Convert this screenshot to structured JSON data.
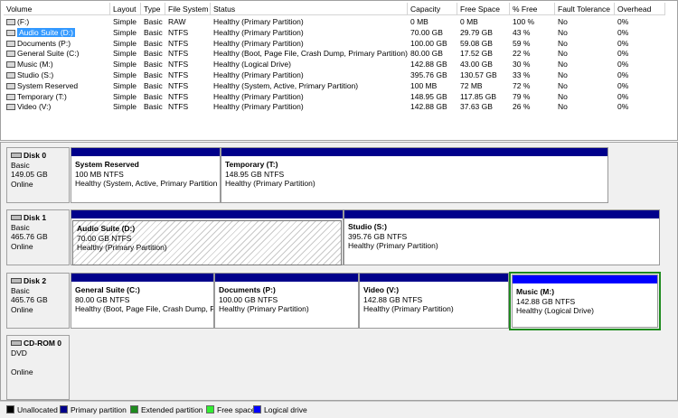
{
  "columns": [
    "Volume",
    "Layout",
    "Type",
    "File System",
    "Status",
    "Capacity",
    "Free Space",
    "% Free",
    "Fault Tolerance",
    "Overhead"
  ],
  "volumes": [
    {
      "name": "(F:)",
      "layout": "Simple",
      "type": "Basic",
      "fs": "RAW",
      "status": "Healthy (Primary Partition)",
      "capacity": "0 MB",
      "free": "0 MB",
      "pct": "100 %",
      "fault": "No",
      "overhead": "0%"
    },
    {
      "name": "Audio Suite (D:)",
      "layout": "Simple",
      "type": "Basic",
      "fs": "NTFS",
      "status": "Healthy (Primary Partition)",
      "capacity": "70.00 GB",
      "free": "29.79 GB",
      "pct": "43 %",
      "fault": "No",
      "overhead": "0%"
    },
    {
      "name": "Documents (P:)",
      "layout": "Simple",
      "type": "Basic",
      "fs": "NTFS",
      "status": "Healthy (Primary Partition)",
      "capacity": "100.00 GB",
      "free": "59.08 GB",
      "pct": "59 %",
      "fault": "No",
      "overhead": "0%"
    },
    {
      "name": "General Suite (C:)",
      "layout": "Simple",
      "type": "Basic",
      "fs": "NTFS",
      "status": "Healthy (Boot, Page File, Crash Dump, Primary Partition)",
      "capacity": "80.00 GB",
      "free": "17.52 GB",
      "pct": "22 %",
      "fault": "No",
      "overhead": "0%"
    },
    {
      "name": "Music (M:)",
      "layout": "Simple",
      "type": "Basic",
      "fs": "NTFS",
      "status": "Healthy (Logical Drive)",
      "capacity": "142.88 GB",
      "free": "43.00 GB",
      "pct": "30 %",
      "fault": "No",
      "overhead": "0%"
    },
    {
      "name": "Studio (S:)",
      "layout": "Simple",
      "type": "Basic",
      "fs": "NTFS",
      "status": "Healthy (Primary Partition)",
      "capacity": "395.76 GB",
      "free": "130.57 GB",
      "pct": "33 %",
      "fault": "No",
      "overhead": "0%"
    },
    {
      "name": "System Reserved",
      "layout": "Simple",
      "type": "Basic",
      "fs": "NTFS",
      "status": "Healthy (System, Active, Primary Partition)",
      "capacity": "100 MB",
      "free": "72 MB",
      "pct": "72 %",
      "fault": "No",
      "overhead": "0%"
    },
    {
      "name": "Temporary (T:)",
      "layout": "Simple",
      "type": "Basic",
      "fs": "NTFS",
      "status": "Healthy (Primary Partition)",
      "capacity": "148.95 GB",
      "free": "117.85 GB",
      "pct": "79 %",
      "fault": "No",
      "overhead": "0%"
    },
    {
      "name": "Video (V:)",
      "layout": "Simple",
      "type": "Basic",
      "fs": "NTFS",
      "status": "Healthy (Primary Partition)",
      "capacity": "142.88 GB",
      "free": "37.63 GB",
      "pct": "26 %",
      "fault": "No",
      "overhead": "0%"
    }
  ],
  "disks": [
    {
      "name": "Disk 0",
      "type": "Basic",
      "size": "149.05 GB",
      "state": "Online",
      "partitions": [
        {
          "title": "System Reserved",
          "size": "100 MB NTFS",
          "status": "Healthy (System, Active, Primary Partition"
        },
        {
          "title": "Temporary  (T:)",
          "size": "148.95 GB NTFS",
          "status": "Healthy (Primary Partition)"
        }
      ]
    },
    {
      "name": "Disk 1",
      "type": "Basic",
      "size": "465.76 GB",
      "state": "Online",
      "partitions": [
        {
          "title": "Audio Suite  (D:)",
          "size": "70.00 GB NTFS",
          "status": "Healthy (Primary Partition)"
        },
        {
          "title": "Studio  (S:)",
          "size": "395.76 GB NTFS",
          "status": "Healthy (Primary Partition)"
        }
      ]
    },
    {
      "name": "Disk 2",
      "type": "Basic",
      "size": "465.76 GB",
      "state": "Online",
      "partitions": [
        {
          "title": "General Suite  (C:)",
          "size": "80.00 GB NTFS",
          "status": "Healthy (Boot, Page File, Crash Dump, P"
        },
        {
          "title": "Documents  (P:)",
          "size": "100.00 GB NTFS",
          "status": "Healthy (Primary Partition)"
        },
        {
          "title": "Video  (V:)",
          "size": "142.88 GB NTFS",
          "status": "Healthy (Primary Partition)"
        },
        {
          "title": "Music  (M:)",
          "size": "142.88 GB NTFS",
          "status": "Healthy (Logical Drive)"
        }
      ]
    },
    {
      "name": "CD-ROM 0",
      "type": "DVD",
      "size": "",
      "state": "Online",
      "partitions": []
    }
  ],
  "legend": [
    {
      "label": "Unallocated",
      "color": "#000000"
    },
    {
      "label": "Primary partition",
      "color": "#00008b"
    },
    {
      "label": "Extended partition",
      "color": "#1e8b1e"
    },
    {
      "label": "Free space",
      "color": "#33ee33"
    },
    {
      "label": "Logical drive",
      "color": "#0000ff"
    }
  ],
  "icons": {
    "volume": "drive-icon",
    "disk": "disk-icon",
    "cdrom": "cdrom-icon"
  }
}
